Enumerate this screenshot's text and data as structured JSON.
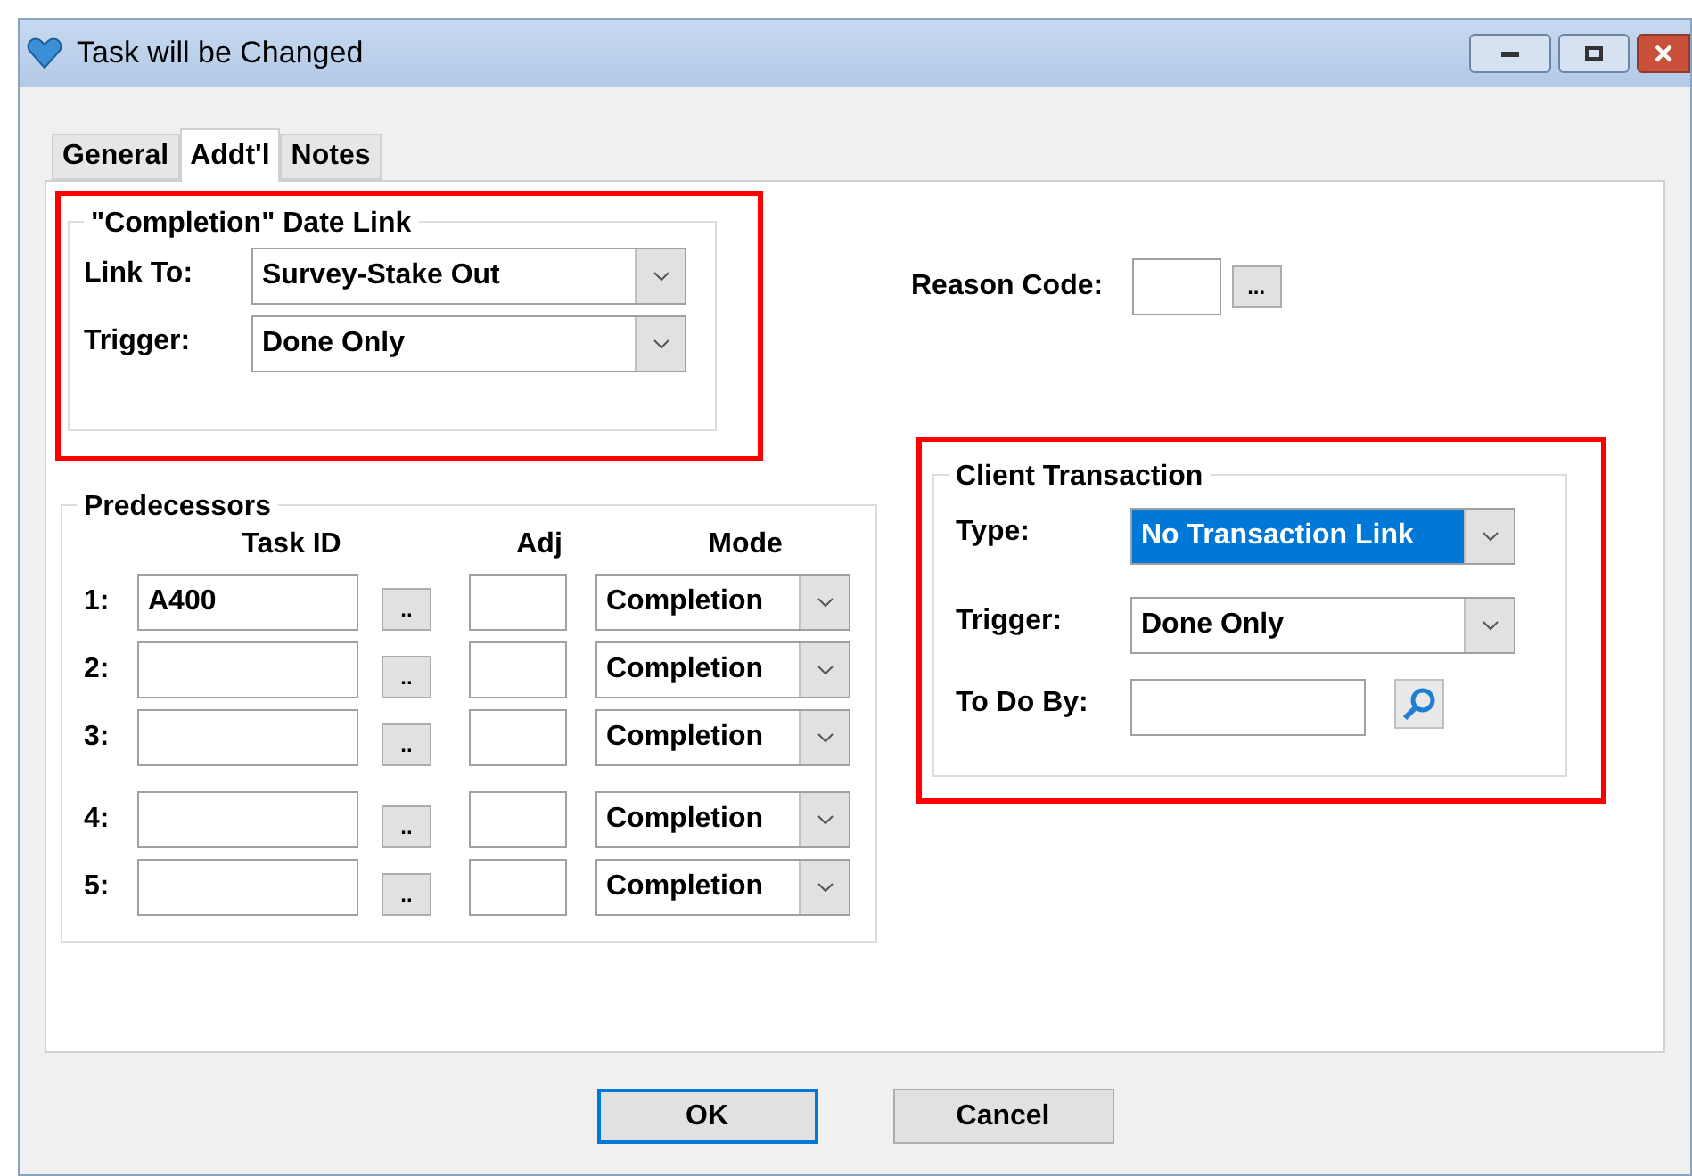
{
  "window": {
    "title": "Task will be Changed"
  },
  "tabs": [
    {
      "label": "General",
      "selected": false
    },
    {
      "label": "Addt'l",
      "selected": true
    },
    {
      "label": "Notes",
      "selected": false
    }
  ],
  "completion_date_link": {
    "title": "\"Completion\" Date Link",
    "highlighted": true,
    "fields": [
      {
        "label": "Link To:",
        "value": "Survey-Stake Out"
      },
      {
        "label": "Trigger:",
        "value": "Done Only"
      }
    ]
  },
  "reason_code": {
    "label": "Reason Code:",
    "browse": "..."
  },
  "predecessors": {
    "title": "Predecessors",
    "columns": [
      "Task ID",
      "Adj",
      "Mode"
    ],
    "rows": [
      {
        "number": "1:",
        "task_id": "A400",
        "browse": "..",
        "mode": "Completion"
      },
      {
        "number": "2:",
        "browse": "..",
        "mode": "Completion"
      },
      {
        "number": "3:",
        "browse": "..",
        "mode": "Completion"
      },
      {
        "number": "4:",
        "browse": "..",
        "mode": "Completion"
      },
      {
        "number": "5:",
        "browse": "..",
        "mode": "Completion"
      }
    ]
  },
  "client_transaction": {
    "title": "Client Transaction",
    "highlighted": true,
    "type": {
      "label": "Type:",
      "value": "No Transaction Link",
      "focused": true
    },
    "trigger": {
      "label": "Trigger:",
      "value": "Done Only",
      "focused": false
    },
    "to_do_by": {
      "label": "To Do By:"
    }
  },
  "buttons": [
    {
      "label": "OK",
      "default": true
    },
    {
      "label": "Cancel",
      "default": false
    }
  ]
}
